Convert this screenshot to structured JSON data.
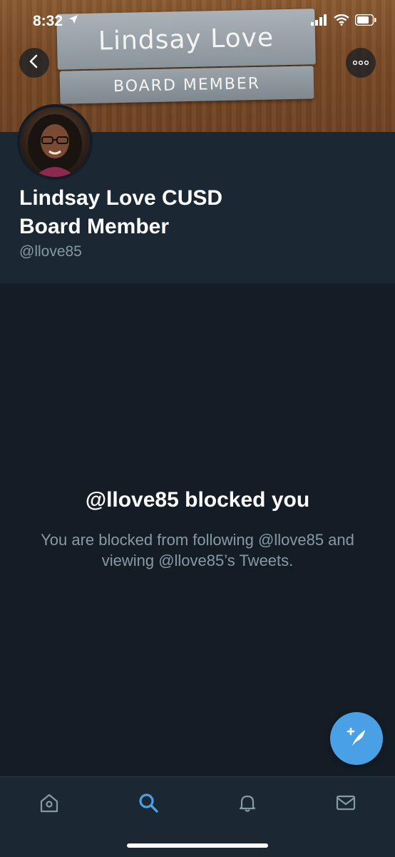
{
  "status_bar": {
    "time": "8:32"
  },
  "banner": {
    "plate_name": "Lindsay Love",
    "plate_title": "BOARD MEMBER"
  },
  "profile": {
    "display_name_line1": "Lindsay Love CUSD",
    "display_name_line2": "Board Member",
    "handle": "@llove85"
  },
  "blocked": {
    "title": "@llove85 blocked you",
    "body": "You are blocked from following @llove85 and viewing @llove85’s Tweets."
  },
  "tabs": [
    "home",
    "search",
    "notifications",
    "messages"
  ],
  "colors": {
    "accent": "#4aa0e5",
    "background": "#141d26",
    "header_bg": "#1b2733",
    "muted_text": "#8899a6"
  }
}
